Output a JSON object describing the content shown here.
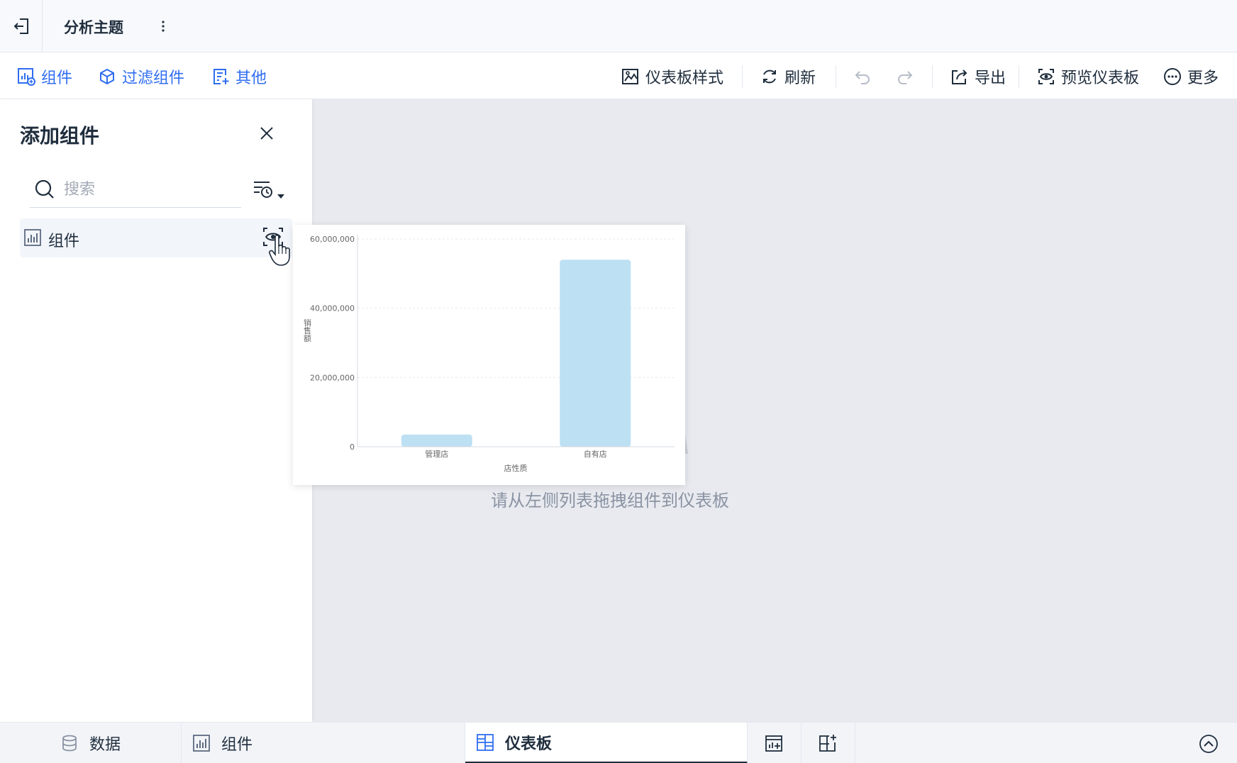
{
  "header": {
    "title": "分析主题"
  },
  "toolbar": {
    "left_items": [
      {
        "label": "组件",
        "icon": "component-chart-icon"
      },
      {
        "label": "过滤组件",
        "icon": "filter-component-icon"
      },
      {
        "label": "其他",
        "icon": "other-icon"
      }
    ],
    "right_items": {
      "style": "仪表板样式",
      "refresh": "刷新",
      "export": "导出",
      "preview": "预览仪表板",
      "more": "更多"
    }
  },
  "panel": {
    "title": "添加组件",
    "search_placeholder": "搜索",
    "items": [
      {
        "label": "组件",
        "icon": "bar-chart-icon"
      }
    ]
  },
  "canvas": {
    "empty_text": "请从左侧列表拖拽组件到仪表板"
  },
  "chart_data": {
    "type": "bar",
    "categories": [
      "管理店",
      "自有店"
    ],
    "values": [
      3500000,
      54000000
    ],
    "xlabel": "店性质",
    "ylabel": "销售额",
    "ylim": [
      0,
      60000000
    ],
    "yticks": [
      0,
      20000000,
      40000000,
      60000000
    ],
    "ytick_labels": [
      "0",
      "20,000,000",
      "40,000,000",
      "60,000,000"
    ],
    "grid": true,
    "bar_color": "#bde0f3"
  },
  "bottom_tabs": [
    {
      "label": "数据",
      "icon": "database-icon"
    },
    {
      "label": "组件",
      "icon": "bar-chart-icon"
    },
    {
      "label": "仪表板",
      "icon": "dashboard-grid-icon",
      "active": true
    }
  ],
  "colors": {
    "accent": "#2f6df0",
    "text": "#1f2d3d",
    "canvas_bg": "#e8eaef"
  }
}
